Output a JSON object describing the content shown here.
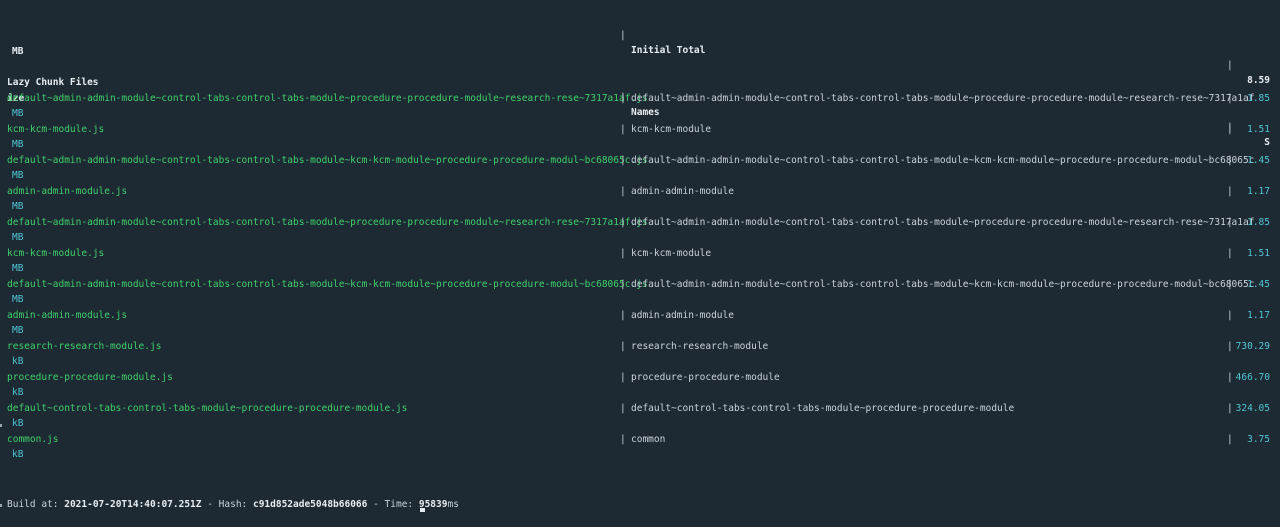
{
  "initial_total": {
    "label": "Initial Total",
    "size": "8.59",
    "unit": "MB"
  },
  "lazy_header": {
    "files": "Lazy Chunk Files",
    "names": "Names",
    "size_tail_1": "S",
    "size_tail_2": "ize"
  },
  "rows": [
    {
      "file": "default~admin-admin-module~control-tabs-control-tabs-module~procedure-procedure-module~research-rese~7317a1af.js",
      "name": "default~admin-admin-module~control-tabs-control-tabs-module~procedure-procedure-module~research-rese~7317a1af",
      "size": "1.85",
      "unit": "MB"
    },
    {
      "file": "kcm-kcm-module.js",
      "name": "kcm-kcm-module",
      "size": "1.51",
      "unit": "MB"
    },
    {
      "file": "default~admin-admin-module~control-tabs-control-tabs-module~kcm-kcm-module~procedure-procedure-modul~bc68065c.js",
      "name": "default~admin-admin-module~control-tabs-control-tabs-module~kcm-kcm-module~procedure-procedure-modul~bc68065c",
      "size": "1.45",
      "unit": "MB"
    },
    {
      "file": "admin-admin-module.js",
      "name": "admin-admin-module",
      "size": "1.17",
      "unit": "MB"
    },
    {
      "file": "default~admin-admin-module~control-tabs-control-tabs-module~procedure-procedure-module~research-rese~7317a1af.js",
      "name": "default~admin-admin-module~control-tabs-control-tabs-module~procedure-procedure-module~research-rese~7317a1af",
      "size": "1.85",
      "unit": "MB"
    },
    {
      "file": "kcm-kcm-module.js",
      "name": "kcm-kcm-module",
      "size": "1.51",
      "unit": "MB"
    },
    {
      "file": "default~admin-admin-module~control-tabs-control-tabs-module~kcm-kcm-module~procedure-procedure-modul~bc68065c.js",
      "name": "default~admin-admin-module~control-tabs-control-tabs-module~kcm-kcm-module~procedure-procedure-modul~bc68065c",
      "size": "1.45",
      "unit": "MB"
    },
    {
      "file": "admin-admin-module.js",
      "name": "admin-admin-module",
      "size": "1.17",
      "unit": "MB"
    },
    {
      "file": "research-research-module.js",
      "name": "research-research-module",
      "size": "730.29",
      "unit": "kB"
    },
    {
      "file": "procedure-procedure-module.js",
      "name": "procedure-procedure-module",
      "size": "466.70",
      "unit": "kB"
    },
    {
      "file": "default~control-tabs-control-tabs-module~procedure-procedure-module.js",
      "name": "default~control-tabs-control-tabs-module~procedure-procedure-module",
      "size": "324.05",
      "unit": "kB"
    },
    {
      "file": "common.js",
      "name": "common",
      "size": "3.75",
      "unit": "kB"
    }
  ],
  "separator": "|",
  "build": {
    "at_label": "Build at:",
    "at_value": "2021-07-20T14:40:07.251Z",
    "hash_sep": " - Hash: ",
    "hash_value": "c91d852ade5048b66066",
    "time_sep": " - Time: ",
    "time_value": "95839",
    "time_unit": "ms"
  },
  "colors": {
    "background": "#1e2a33",
    "file_green": "#3fd16b",
    "size_cyan": "#4fc6d6",
    "text": "#c9d1d9"
  }
}
